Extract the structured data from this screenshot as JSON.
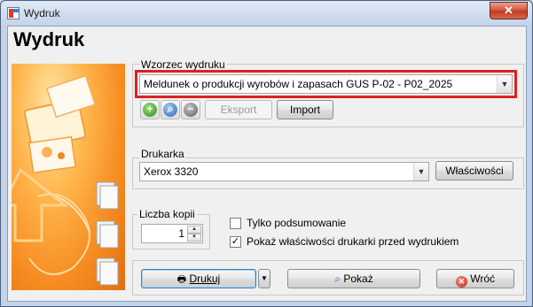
{
  "window": {
    "title": "Wydruk",
    "close_label": "✕"
  },
  "page": {
    "title": "Wydruk"
  },
  "template_section": {
    "label": "Wzorzec wydruku",
    "selected": "Meldunek o produkcji wyrobów i  zapasach GUS P-02  -  P02_2025",
    "toolbar": {
      "add_icon": "plus-icon",
      "preview_icon": "magnifier-icon",
      "remove_icon": "minus-icon",
      "export_label": "Eksport",
      "import_label": "Import"
    }
  },
  "printer_section": {
    "label": "Drukarka",
    "selected": "Xerox 3320",
    "properties_label": "Właściwości"
  },
  "copies_section": {
    "label": "Liczba kopii",
    "value": "1"
  },
  "options": [
    {
      "label": "Tylko podsumowanie",
      "checked": false
    },
    {
      "label": "Pokaż właściwości drukarki przed wydrukiem",
      "checked": true
    }
  ],
  "actions": {
    "print_label": "Drukuj",
    "preview_label": "Pokaż",
    "back_label": "Wróć"
  },
  "colors": {
    "accent_red": "#e02020",
    "art_orange": "#f58a1f",
    "title_bar": "#c4d3e8"
  }
}
